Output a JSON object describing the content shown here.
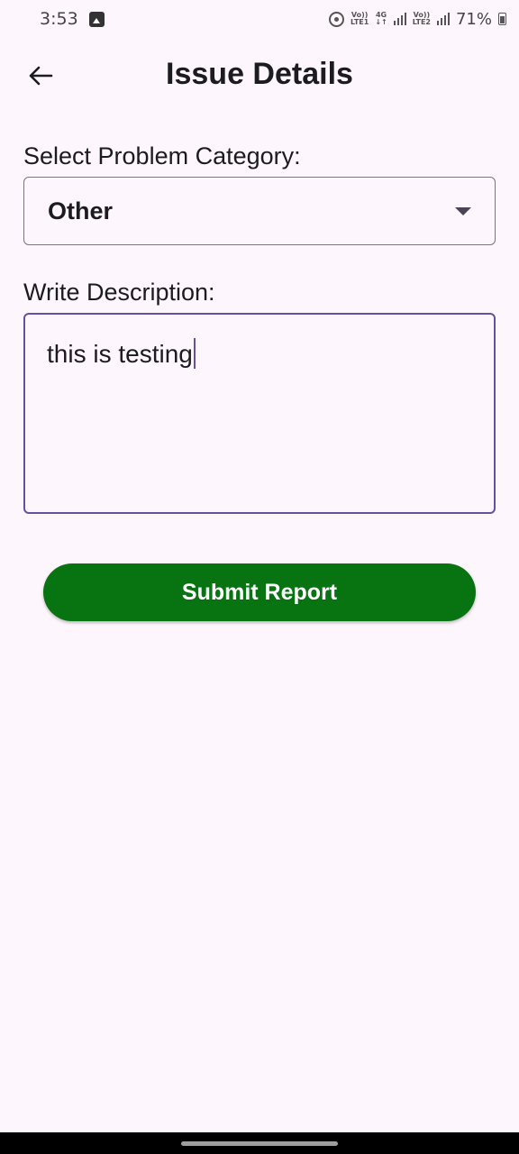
{
  "status_bar": {
    "time": "3:53",
    "net1_top": "Vo))",
    "net1_bottom": "LTE1",
    "net_type": "4G",
    "net2_top": "Vo))",
    "net2_bottom": "LTE2",
    "battery": "71%"
  },
  "app_bar": {
    "title": "Issue Details"
  },
  "form": {
    "category_label": "Select Problem Category:",
    "category_value": "Other",
    "description_label": "Write Description:",
    "description_value": "this is testing",
    "submit_label": "Submit Report"
  },
  "colors": {
    "background": "#fdf7fd",
    "accent": "#6750a4",
    "submit": "#087311"
  },
  "icons": {
    "back": "arrow-left-icon",
    "dropdown": "caret-down-icon",
    "gallery": "gallery-icon",
    "hotspot": "hotspot-icon",
    "battery": "battery-icon"
  }
}
